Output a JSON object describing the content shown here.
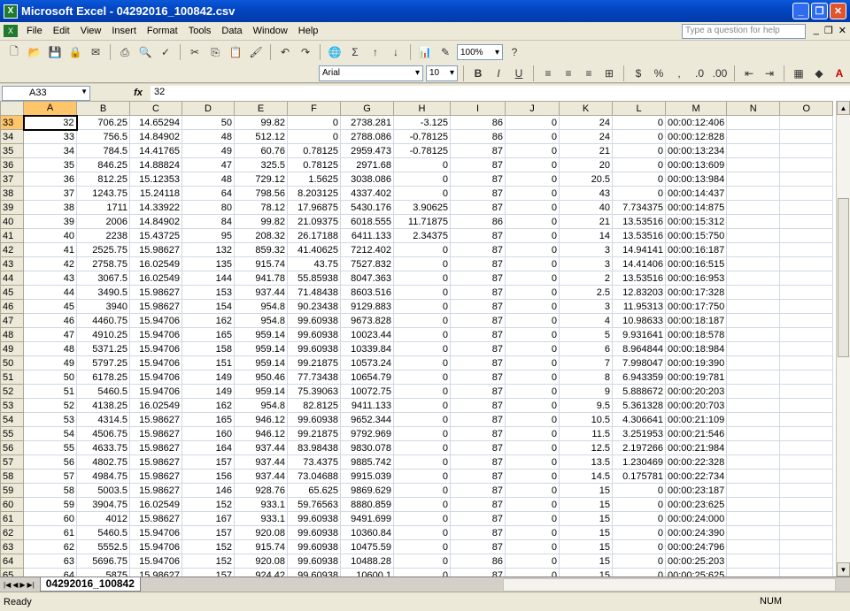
{
  "window": {
    "title": "Microsoft Excel - 04292016_100842.csv",
    "icon": "excel-icon"
  },
  "menu": {
    "items": [
      "File",
      "Edit",
      "View",
      "Insert",
      "Format",
      "Tools",
      "Data",
      "Window",
      "Help"
    ],
    "help_placeholder": "Type a question for help"
  },
  "toolbar": {
    "zoom": "100%",
    "font": "Arial",
    "font_size": "10"
  },
  "formula_bar": {
    "cell_ref": "A33",
    "fx_label": "fx",
    "value": "32"
  },
  "columns": [
    "A",
    "B",
    "C",
    "D",
    "E",
    "F",
    "G",
    "H",
    "I",
    "J",
    "K",
    "L",
    "M",
    "N",
    "O"
  ],
  "selected_column": "A",
  "rows": [
    [
      "33",
      "32",
      "706.25",
      "14.65294",
      "50",
      "99.82",
      "0",
      "2738.281",
      "-3.125",
      "86",
      "0",
      "24",
      "0",
      "00:00:12:406",
      "",
      ""
    ],
    [
      "34",
      "33",
      "756.5",
      "14.84902",
      "48",
      "512.12",
      "0",
      "2788.086",
      "-0.78125",
      "86",
      "0",
      "24",
      "0",
      "00:00:12:828",
      "",
      ""
    ],
    [
      "35",
      "34",
      "784.5",
      "14.41765",
      "49",
      "60.76",
      "0.78125",
      "2959.473",
      "-0.78125",
      "87",
      "0",
      "21",
      "0",
      "00:00:13:234",
      "",
      ""
    ],
    [
      "36",
      "35",
      "846.25",
      "14.88824",
      "47",
      "325.5",
      "0.78125",
      "2971.68",
      "0",
      "87",
      "0",
      "20",
      "0",
      "00:00:13:609",
      "",
      ""
    ],
    [
      "37",
      "36",
      "812.25",
      "15.12353",
      "48",
      "729.12",
      "1.5625",
      "3038.086",
      "0",
      "87",
      "0",
      "20.5",
      "0",
      "00:00:13:984",
      "",
      ""
    ],
    [
      "38",
      "37",
      "1243.75",
      "15.24118",
      "64",
      "798.56",
      "8.203125",
      "4337.402",
      "0",
      "87",
      "0",
      "43",
      "0",
      "00:00:14:437",
      "",
      ""
    ],
    [
      "39",
      "38",
      "1711",
      "14.33922",
      "80",
      "78.12",
      "17.96875",
      "5430.176",
      "3.90625",
      "87",
      "0",
      "40",
      "7.734375",
      "00:00:14:875",
      "",
      ""
    ],
    [
      "40",
      "39",
      "2006",
      "14.84902",
      "84",
      "99.82",
      "21.09375",
      "6018.555",
      "11.71875",
      "86",
      "0",
      "21",
      "13.53516",
      "00:00:15:312",
      "",
      ""
    ],
    [
      "41",
      "40",
      "2238",
      "15.43725",
      "95",
      "208.32",
      "26.17188",
      "6411.133",
      "2.34375",
      "87",
      "0",
      "14",
      "13.53516",
      "00:00:15:750",
      "",
      ""
    ],
    [
      "42",
      "41",
      "2525.75",
      "15.98627",
      "132",
      "859.32",
      "41.40625",
      "7212.402",
      "0",
      "87",
      "0",
      "3",
      "14.94141",
      "00:00:16:187",
      "",
      ""
    ],
    [
      "43",
      "42",
      "2758.75",
      "16.02549",
      "135",
      "915.74",
      "43.75",
      "7527.832",
      "0",
      "87",
      "0",
      "3",
      "14.41406",
      "00:00:16:515",
      "",
      ""
    ],
    [
      "44",
      "43",
      "3067.5",
      "16.02549",
      "144",
      "941.78",
      "55.85938",
      "8047.363",
      "0",
      "87",
      "0",
      "2",
      "13.53516",
      "00:00:16:953",
      "",
      ""
    ],
    [
      "45",
      "44",
      "3490.5",
      "15.98627",
      "153",
      "937.44",
      "71.48438",
      "8603.516",
      "0",
      "87",
      "0",
      "2.5",
      "12.83203",
      "00:00:17:328",
      "",
      ""
    ],
    [
      "46",
      "45",
      "3940",
      "15.98627",
      "154",
      "954.8",
      "90.23438",
      "9129.883",
      "0",
      "87",
      "0",
      "3",
      "11.95313",
      "00:00:17:750",
      "",
      ""
    ],
    [
      "47",
      "46",
      "4460.75",
      "15.94706",
      "162",
      "954.8",
      "99.60938",
      "9673.828",
      "0",
      "87",
      "0",
      "4",
      "10.98633",
      "00:00:18:187",
      "",
      ""
    ],
    [
      "48",
      "47",
      "4910.25",
      "15.94706",
      "165",
      "959.14",
      "99.60938",
      "10023.44",
      "0",
      "87",
      "0",
      "5",
      "9.931641",
      "00:00:18:578",
      "",
      ""
    ],
    [
      "49",
      "48",
      "5371.25",
      "15.94706",
      "158",
      "959.14",
      "99.60938",
      "10339.84",
      "0",
      "87",
      "0",
      "6",
      "8.964844",
      "00:00:18:984",
      "",
      ""
    ],
    [
      "50",
      "49",
      "5797.25",
      "15.94706",
      "151",
      "959.14",
      "99.21875",
      "10573.24",
      "0",
      "87",
      "0",
      "7",
      "7.998047",
      "00:00:19:390",
      "",
      ""
    ],
    [
      "51",
      "50",
      "6178.25",
      "15.94706",
      "149",
      "950.46",
      "77.73438",
      "10654.79",
      "0",
      "87",
      "0",
      "8",
      "6.943359",
      "00:00:19:781",
      "",
      ""
    ],
    [
      "52",
      "51",
      "5460.5",
      "15.94706",
      "149",
      "959.14",
      "75.39063",
      "10072.75",
      "0",
      "87",
      "0",
      "9",
      "5.888672",
      "00:00:20:203",
      "",
      ""
    ],
    [
      "53",
      "52",
      "4138.25",
      "16.02549",
      "162",
      "954.8",
      "82.8125",
      "9411.133",
      "0",
      "87",
      "0",
      "9.5",
      "5.361328",
      "00:00:20:703",
      "",
      ""
    ],
    [
      "54",
      "53",
      "4314.5",
      "15.98627",
      "165",
      "946.12",
      "99.60938",
      "9652.344",
      "0",
      "87",
      "0",
      "10.5",
      "4.306641",
      "00:00:21:109",
      "",
      ""
    ],
    [
      "55",
      "54",
      "4506.75",
      "15.98627",
      "160",
      "946.12",
      "99.21875",
      "9792.969",
      "0",
      "87",
      "0",
      "11.5",
      "3.251953",
      "00:00:21:546",
      "",
      ""
    ],
    [
      "56",
      "55",
      "4633.75",
      "15.98627",
      "164",
      "937.44",
      "83.98438",
      "9830.078",
      "0",
      "87",
      "0",
      "12.5",
      "2.197266",
      "00:00:21:984",
      "",
      ""
    ],
    [
      "57",
      "56",
      "4802.75",
      "15.98627",
      "157",
      "937.44",
      "73.4375",
      "9885.742",
      "0",
      "87",
      "0",
      "13.5",
      "1.230469",
      "00:00:22:328",
      "",
      ""
    ],
    [
      "58",
      "57",
      "4984.75",
      "15.98627",
      "156",
      "937.44",
      "73.04688",
      "9915.039",
      "0",
      "87",
      "0",
      "14.5",
      "0.175781",
      "00:00:22:734",
      "",
      ""
    ],
    [
      "59",
      "58",
      "5003.5",
      "15.98627",
      "146",
      "928.76",
      "65.625",
      "9869.629",
      "0",
      "87",
      "0",
      "15",
      "0",
      "00:00:23:187",
      "",
      ""
    ],
    [
      "60",
      "59",
      "3904.75",
      "16.02549",
      "152",
      "933.1",
      "59.76563",
      "8880.859",
      "0",
      "87",
      "0",
      "15",
      "0",
      "00:00:23:625",
      "",
      ""
    ],
    [
      "61",
      "60",
      "4012",
      "15.98627",
      "167",
      "933.1",
      "99.60938",
      "9491.699",
      "0",
      "87",
      "0",
      "15",
      "0",
      "00:00:24:000",
      "",
      ""
    ],
    [
      "62",
      "61",
      "5460.5",
      "15.94706",
      "157",
      "920.08",
      "99.60938",
      "10360.84",
      "0",
      "87",
      "0",
      "15",
      "0",
      "00:00:24:390",
      "",
      ""
    ],
    [
      "63",
      "62",
      "5552.5",
      "15.94706",
      "152",
      "915.74",
      "99.60938",
      "10475.59",
      "0",
      "87",
      "0",
      "15",
      "0",
      "00:00:24:796",
      "",
      ""
    ],
    [
      "64",
      "63",
      "5696.75",
      "15.94706",
      "152",
      "920.08",
      "99.60938",
      "10488.28",
      "0",
      "86",
      "0",
      "15",
      "0",
      "00:00:25:203",
      "",
      ""
    ],
    [
      "65",
      "64",
      "5875",
      "15.98627",
      "157",
      "924.42",
      "99.60938",
      "10600.1",
      "0",
      "87",
      "0",
      "15",
      "0",
      "00:00:25:625",
      "",
      ""
    ]
  ],
  "sheet_tab": "04292016_100842",
  "status": {
    "left": "Ready",
    "num": "NUM"
  }
}
